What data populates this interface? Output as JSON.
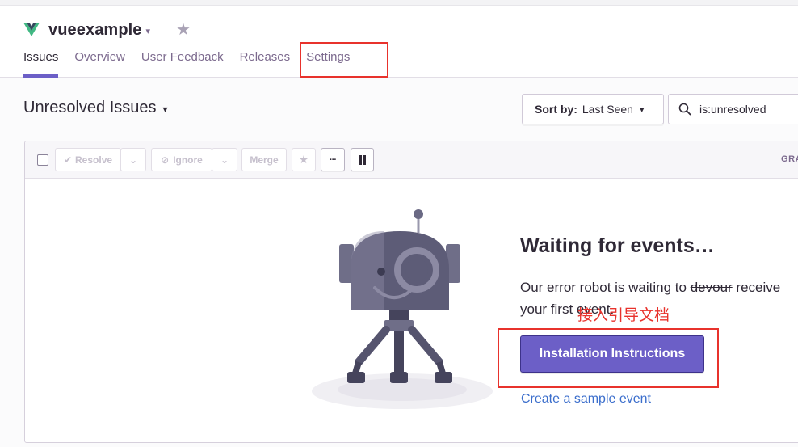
{
  "header": {
    "project_name": "vueexample",
    "tabs": [
      {
        "label": "Issues",
        "active": true
      },
      {
        "label": "Overview"
      },
      {
        "label": "User Feedback"
      },
      {
        "label": "Releases"
      },
      {
        "label": "Settings"
      }
    ]
  },
  "issues": {
    "title": "Unresolved Issues",
    "sort_prefix": "Sort by:",
    "sort_value": "Last Seen",
    "search_value": "is:unresolved"
  },
  "toolbar": {
    "resolve": "Resolve",
    "ignore": "Ignore",
    "merge": "Merge",
    "more": "···",
    "graph": "GRA"
  },
  "empty_state": {
    "title": "Waiting for events…",
    "desc_part1": "Our error robot is waiting to",
    "desc_strike": "devour",
    "desc_part2": "receive your first event.",
    "install_button": "Installation Instructions",
    "sample_link": "Create a sample event"
  },
  "annotation": {
    "note": "接入引导文档"
  },
  "colors": {
    "accent": "#6c5fc7",
    "annotation_red": "#e8322c",
    "link": "#3b6ecc",
    "vue_green": "#41b883",
    "vue_dark": "#35495e"
  }
}
